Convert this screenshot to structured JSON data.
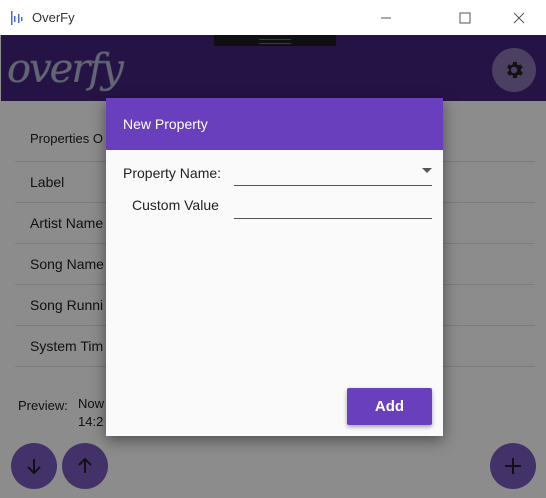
{
  "window": {
    "title": "OverFy",
    "minimize_icon": "minimize-icon",
    "maximize_icon": "maximize-icon",
    "close_icon": "close-icon"
  },
  "appbar": {
    "logo_text": "overfy",
    "settings_icon": "gear-icon"
  },
  "list": {
    "header": "Properties O",
    "items": [
      "Label",
      "Artist Name",
      "Song Name",
      "Song Runni",
      "System Tim"
    ]
  },
  "preview": {
    "label": "Preview:",
    "line1": "Now",
    "line2": "14:2"
  },
  "fabs": {
    "down_icon": "arrow-down-icon",
    "up_icon": "arrow-up-icon",
    "add_icon": "plus-icon"
  },
  "dialog": {
    "title": "New Property",
    "property_name_label": "Property Name:",
    "property_name_value": "",
    "custom_value_label": "Custom Value",
    "custom_value_value": "",
    "add_label": "Add"
  },
  "colors": {
    "appbar": "#44237f",
    "accent": "#6a3fbd",
    "fab": "#7a5bc0",
    "scrim": "rgba(0,0,0,0.45)"
  }
}
